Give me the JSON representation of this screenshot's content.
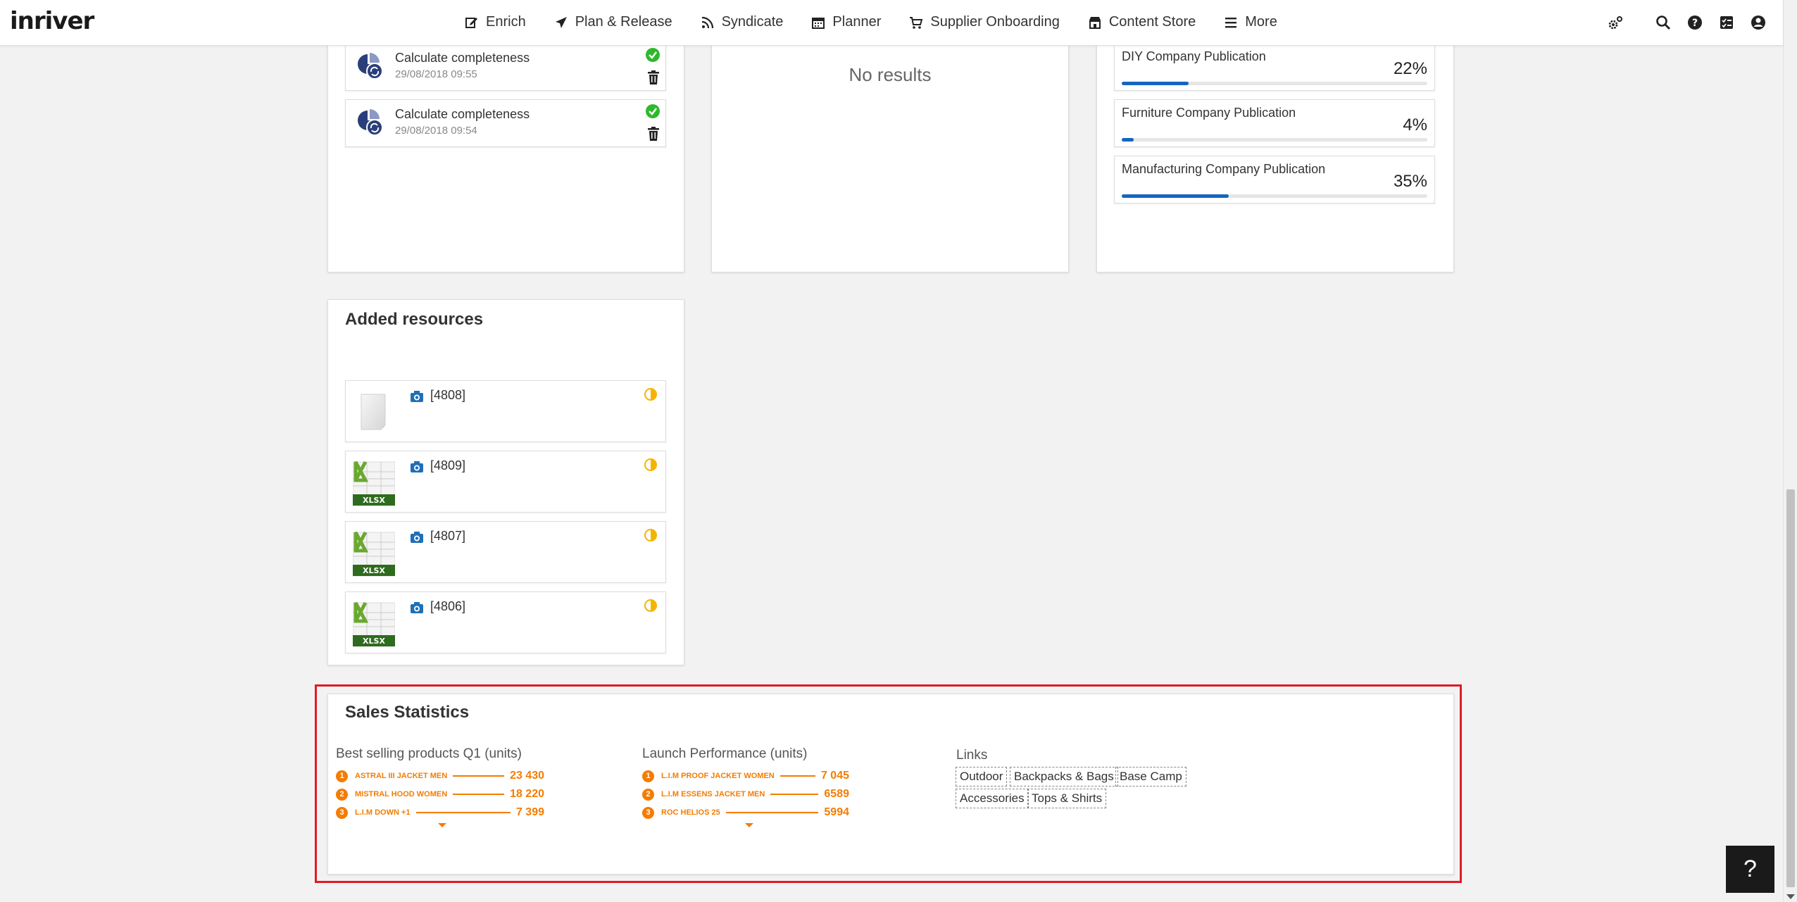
{
  "app": {
    "logo": "inriver"
  },
  "nav": {
    "items": [
      {
        "label": "Enrich",
        "icon": "edit-icon"
      },
      {
        "label": "Plan & Release",
        "icon": "paper-plane-icon"
      },
      {
        "label": "Syndicate",
        "icon": "rss-icon"
      },
      {
        "label": "Planner",
        "icon": "calendar-icon"
      },
      {
        "label": "Supplier Onboarding",
        "icon": "cart-icon"
      },
      {
        "label": "Content Store",
        "icon": "store-icon"
      },
      {
        "label": "More",
        "icon": "hamburger-icon"
      }
    ],
    "right_icons": [
      "settings-icon",
      "search-icon",
      "help-icon",
      "tasks-icon",
      "user-icon"
    ]
  },
  "jobs": [
    {
      "title": "Calculate completeness",
      "date": "29/08/2018 09:55"
    },
    {
      "title": "Calculate completeness",
      "date": "29/08/2018 09:54"
    }
  ],
  "middle_panel": {
    "empty_text": "No results"
  },
  "publications": [
    {
      "name": "DIY Company Publication",
      "percent_label": "22%",
      "percent": 22
    },
    {
      "name": "Furniture Company Publication",
      "percent_label": "4%",
      "percent": 4
    },
    {
      "name": "Manufacturing Company Publication",
      "percent_label": "35%",
      "percent": 35
    }
  ],
  "added_resources": {
    "title": "Added resources",
    "items": [
      {
        "id": "[4808]",
        "thumb": "blank-file"
      },
      {
        "id": "[4809]",
        "thumb": "xlsx"
      },
      {
        "id": "[4807]",
        "thumb": "xlsx"
      },
      {
        "id": "[4806]",
        "thumb": "xlsx"
      }
    ],
    "xlsx_label": "XLSX"
  },
  "sales_statistics": {
    "title": "Sales Statistics",
    "best_selling": {
      "title": "Best selling products Q1 (units)",
      "rows": [
        {
          "rank": "1",
          "name": "ASTRAL III JACKET MEN",
          "value": "23 430"
        },
        {
          "rank": "2",
          "name": "MISTRAL HOOD WOMEN",
          "value": "18 220"
        },
        {
          "rank": "3",
          "name": "L.I.M DOWN +1",
          "value": "7 399"
        }
      ]
    },
    "launch_performance": {
      "title": "Launch Performance (units)",
      "rows": [
        {
          "rank": "1",
          "name": "L.I.M PROOF JACKET WOMEN",
          "value": "7 045"
        },
        {
          "rank": "2",
          "name": "L.I.M ESSENS JACKET MEN",
          "value": "6589"
        },
        {
          "rank": "3",
          "name": "ROC HELIOS 25",
          "value": "5994"
        }
      ]
    },
    "links": {
      "title": "Links",
      "items": [
        "Outdoor",
        "Backpacks & Bags",
        "Base Camp",
        "Accessories",
        "Tops & Shirts"
      ]
    }
  },
  "help_button": {
    "label": "?"
  },
  "colors": {
    "accent": "#f57c00",
    "progress": "#1565c0",
    "success": "#2eb82e",
    "status_pending": "#f5b400",
    "highlight": "#e01b24"
  }
}
